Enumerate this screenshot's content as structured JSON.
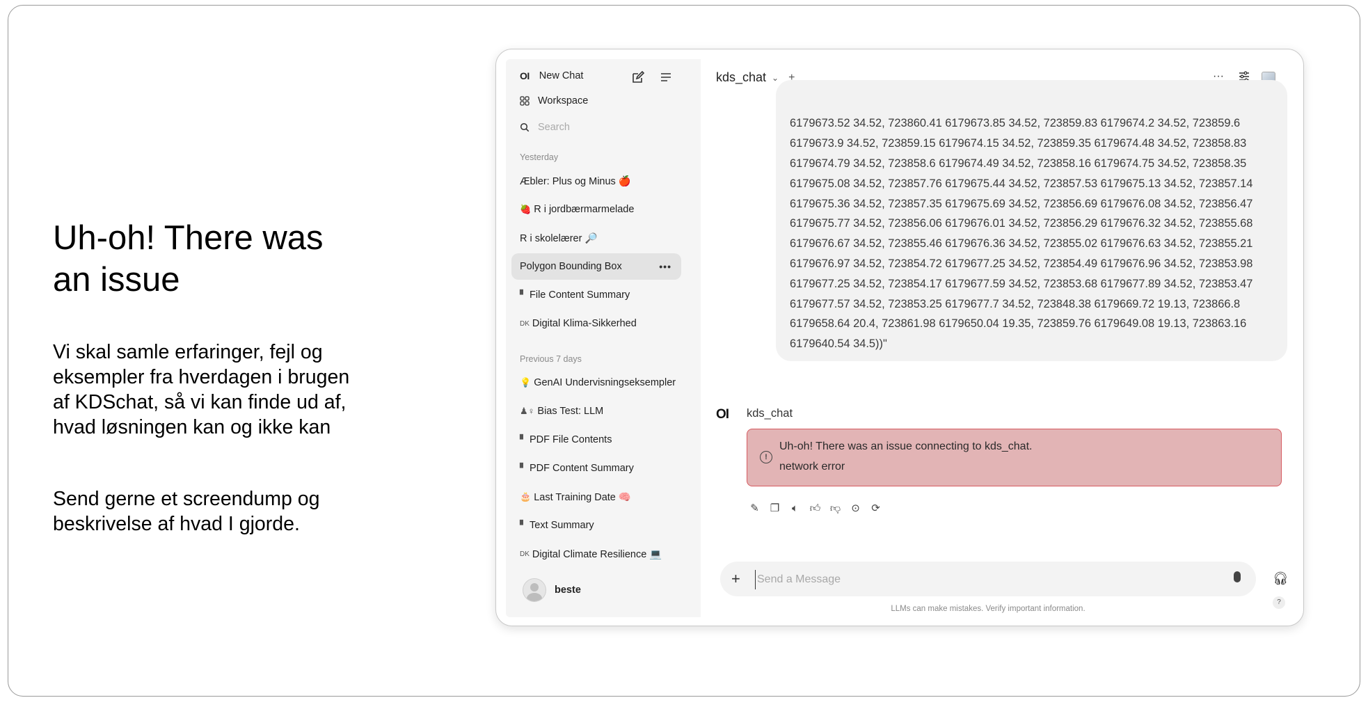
{
  "slide": {
    "title": "Uh-oh! There was an issue",
    "body": "Vi skal samle erfaringer, fejl og eksempler fra hverdagen i brugen af KDSchat, så vi kan finde ud af, hvad løsningen kan og ikke kan",
    "body2": "Send gerne et screendump og beskrivelse af hvad I gjorde."
  },
  "sidebar": {
    "logo": "OI",
    "new_chat": "New Chat",
    "workspace": "Workspace",
    "search_placeholder": "Search",
    "sections": [
      "Yesterday",
      "Previous 7 days"
    ],
    "yesterday_items": [
      {
        "label": "Æbler: Plus og Minus 🍎"
      },
      {
        "emoji": "🍓",
        "label": "R i jordbærmarmelade"
      },
      {
        "label": "R i skolelærer 🔎"
      },
      {
        "label": "Polygon Bounding Box",
        "more": "•••"
      },
      {
        "emoji": "▘",
        "label": "File Content Summary"
      },
      {
        "emoji": "DK",
        "label": "Digital Klima-Sikkerhed"
      }
    ],
    "week_items": [
      {
        "emoji": "💡",
        "label": "GenAI Undervisningseksempler"
      },
      {
        "emoji": "♟♀",
        "label": "Bias Test: LLM"
      },
      {
        "emoji": "▘",
        "label": "PDF File Contents"
      },
      {
        "emoji": "▘",
        "label": "PDF Content Summary"
      },
      {
        "emoji": "🎂",
        "label": "Last Training Date 🧠"
      },
      {
        "emoji": "▘",
        "label": "Text Summary"
      },
      {
        "emoji": "DK",
        "label": "Digital Climate Resilience 💻"
      }
    ],
    "user_name": "beste"
  },
  "header": {
    "model": "kds_chat",
    "chevron": "⌄",
    "plus": "+",
    "more": "···",
    "controls": "☰"
  },
  "chat": {
    "user_message": "6179673.52 34.52, 723860.41 6179673.85 34.52, 723859.83 6179674.2 34.52, 723859.6 6179673.9 34.52, 723859.15 6179674.15 34.52, 723859.35 6179674.48 34.52, 723858.83 6179674.79 34.52, 723858.6 6179674.49 34.52, 723858.16 6179674.75 34.52, 723858.35 6179675.08 34.52, 723857.76 6179675.44 34.52, 723857.53 6179675.13 34.52, 723857.14 6179675.36 34.52, 723857.35 6179675.69 34.52, 723856.69 6179676.08 34.52, 723856.47 6179675.77 34.52, 723856.06 6179676.01 34.52, 723856.29 6179676.32 34.52, 723855.68 6179676.67 34.52, 723855.46 6179676.36 34.52, 723855.02 6179676.63 34.52, 723855.21 6179676.97 34.52, 723854.72 6179677.25 34.52, 723854.49 6179676.96 34.52, 723853.98 6179677.25 34.52, 723854.17 6179677.59 34.52, 723853.68 6179677.89 34.52, 723853.47 6179677.57 34.52, 723853.25 6179677.7 34.52, 723848.38 6179669.72 19.13, 723866.8 6179658.64 20.4, 723861.98 6179650.04 19.35, 723859.76 6179649.08 19.13, 723863.16 6179640.54 34.5))\"",
    "response_logo": "OI",
    "response_name": "kds_chat",
    "error_line1": "Uh-oh! There was an issue connecting to kds_chat.",
    "error_line2": "network error",
    "input_placeholder": "Send a Message",
    "footer_note": "LLMs can make mistakes. Verify important information.",
    "help": "?"
  },
  "colors": {
    "error_bg": "#e2b4b5",
    "error_border": "#d65a60",
    "sidebar_bg": "#f5f5f5",
    "active_item": "#e3e3e3"
  }
}
